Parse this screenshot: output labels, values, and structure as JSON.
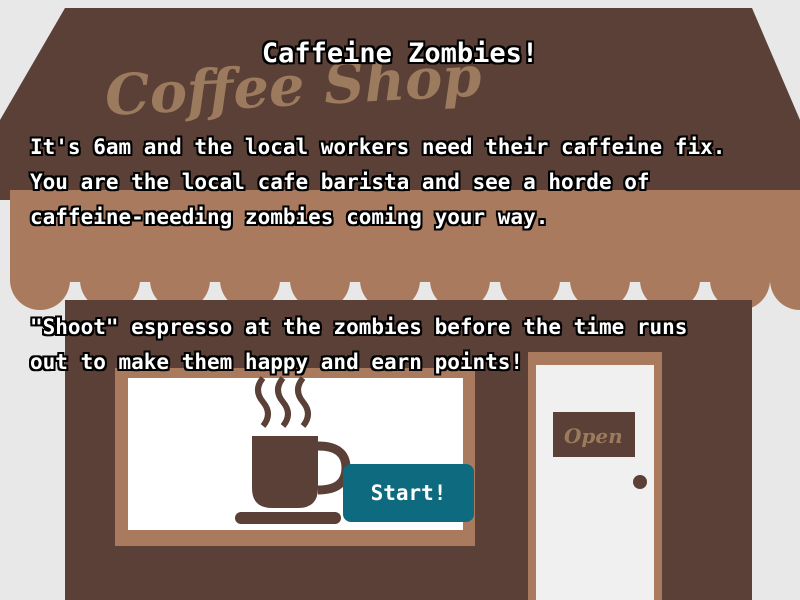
{
  "game": {
    "title": "Caffeine Zombies!",
    "intro": "It's 6am and the local workers need their caffeine fix.\nYou are the local cafe barista and see a horde of\ncaffeine-needing zombies coming your way.",
    "instructions": "\"Shoot\" espresso at the zombies before the time runs\nout to make them happy and earn points!",
    "start_label": "Start!"
  },
  "scene": {
    "shop_sign": "Coffee Shop",
    "door_sign": "Open"
  },
  "colors": {
    "background": "#e8e8e8",
    "building": "#5a4036",
    "awning": "#a97a5d",
    "window_frame": "#a97a5d",
    "window_glass": "#ffffff",
    "door": "#f0f0f0",
    "button": "#0e6a7f",
    "text": "#ffffff"
  }
}
